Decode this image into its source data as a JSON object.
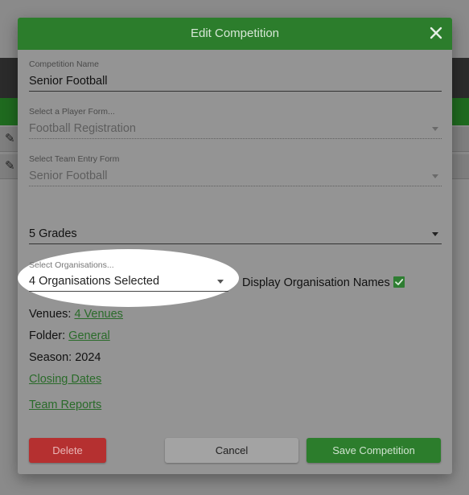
{
  "modal": {
    "title": "Edit Competition",
    "close_symbol": "✕"
  },
  "fields": {
    "competition_name": {
      "label": "Competition Name",
      "value": "Senior Football"
    },
    "player_form": {
      "label": "Select a Player Form...",
      "value": "Football Registration"
    },
    "team_entry_form": {
      "label": "Select Team Entry Form",
      "value": "Senior Football"
    },
    "grades": {
      "value": "5 Grades"
    },
    "organisations": {
      "label": "Select Organisations...",
      "value": "4 Organisations Selected"
    }
  },
  "display_org_names": {
    "label": "Display Organisation Names",
    "checked": true
  },
  "info": {
    "venues_label": "Venues:",
    "venues_link": "4 Venues",
    "folder_label": "Folder:",
    "folder_link": "General",
    "season_text": "Season: 2024",
    "closing_dates": "Closing Dates",
    "team_reports": "Team Reports"
  },
  "buttons": {
    "delete": "Delete",
    "cancel": "Cancel",
    "save": "Save Competition"
  },
  "colors": {
    "header_green": "#2c7d2c",
    "delete_red": "#b53030",
    "link_green": "#2a6b2a"
  },
  "icons": {
    "row_edit": "pencil-icon",
    "dropdown": "caret-down-icon",
    "close": "close-icon",
    "check": "check-icon"
  }
}
